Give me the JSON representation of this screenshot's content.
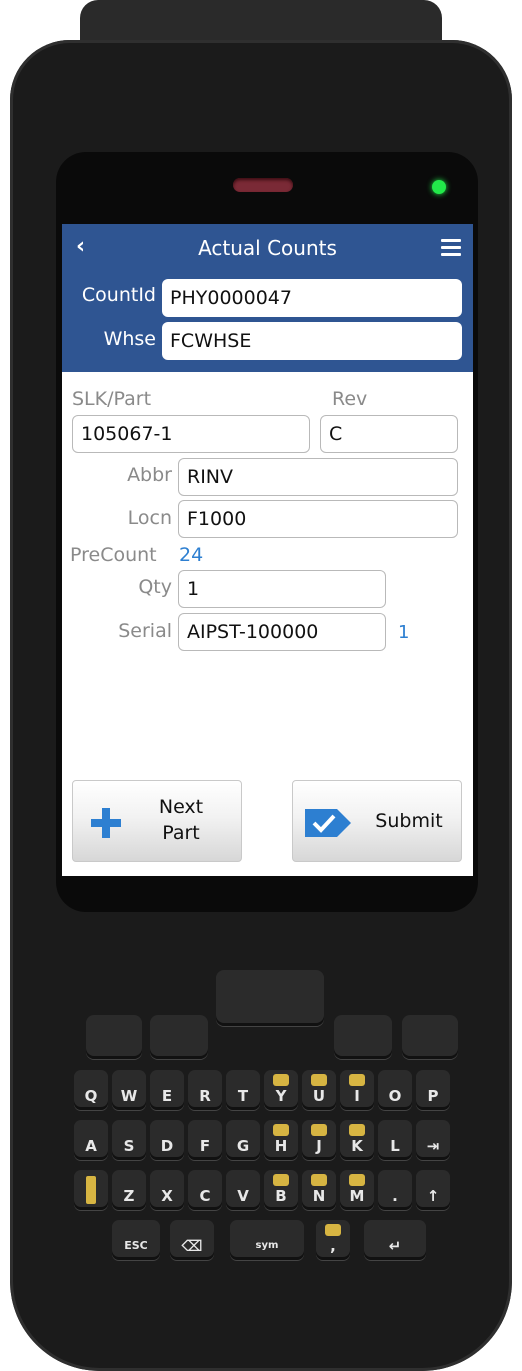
{
  "header": {
    "title": "Actual Counts",
    "count_id_label": "CountId",
    "count_id_value": "PHY0000047",
    "whse_label": "Whse",
    "whse_value": "FCWHSE"
  },
  "form": {
    "slk_part_label": "SLK/Part",
    "slk_part_value": "105067-1",
    "rev_label": "Rev",
    "rev_value": "C",
    "abbr_label": "Abbr",
    "abbr_value": "RINV",
    "locn_label": "Locn",
    "locn_value": "F1000",
    "precount_label": "PreCount",
    "precount_value": "24",
    "qty_label": "Qty",
    "qty_value": "1",
    "serial_label": "Serial",
    "serial_value": "AIPST-100000",
    "serial_count": "1"
  },
  "buttons": {
    "next_part_line1": "Next",
    "next_part_line2": "Part",
    "submit": "Submit"
  },
  "keypad": {
    "row1": [
      "Q",
      "W",
      "E",
      "R",
      "T",
      "Y",
      "U",
      "I",
      "O",
      "P"
    ],
    "row2": [
      "A",
      "S",
      "D",
      "F",
      "G",
      "H",
      "J",
      "K",
      "L"
    ],
    "row3": [
      "Z",
      "X",
      "C",
      "V",
      "B",
      "N",
      "M",
      "."
    ],
    "esc": "ESC",
    "sym": "sym",
    "comma": ","
  },
  "colors": {
    "header_bg": "#2f5592",
    "accent_blue": "#2d7fd1",
    "led_green": "#22e94a"
  }
}
